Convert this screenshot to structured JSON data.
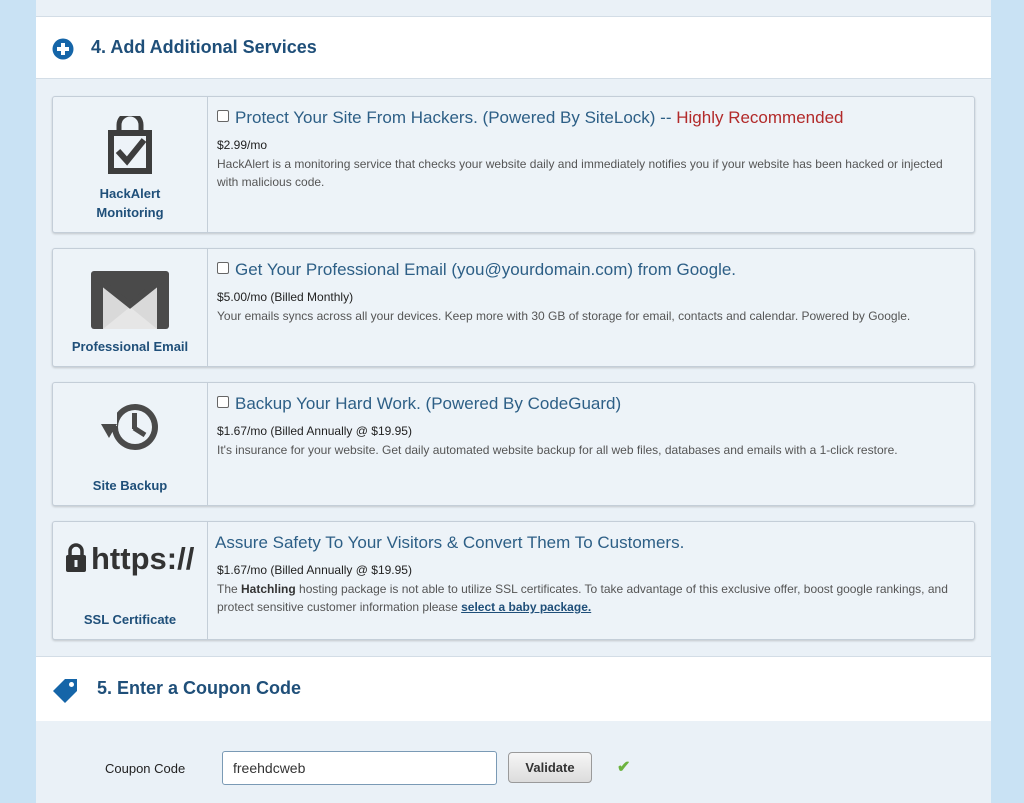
{
  "colors": {
    "accent": "#1f4f79",
    "offer_text": "#2d5f86",
    "highlight": "#b22a2a",
    "success": "#6cb33f",
    "outer_bg": "#c9e2f4"
  },
  "section4": {
    "title": "4. Add Additional Services",
    "icon": "plus-circle-icon"
  },
  "services": [
    {
      "label_line1": "HackAlert",
      "label_line2": "Monitoring",
      "icon": "shield-check-icon",
      "offer": "Protect Your Site From Hackers. (Powered By SiteLock) --",
      "offer_highlight": "Highly Recommended",
      "price": "$2.99/mo",
      "description": "HackAlert is a monitoring service that checks your website daily and immediately notifies you if your website has been hacked or injected with malicious code.",
      "checked": false
    },
    {
      "label_line1": "Professional Email",
      "icon": "gmail-envelope-icon",
      "offer": "Get Your Professional Email (you@yourdomain.com) from Google.",
      "price": "$5.00/mo (Billed Monthly)",
      "description": "Your emails syncs across all your devices. Keep more with 30 GB of storage for email, contacts and calendar. Powered by Google.",
      "checked": false
    },
    {
      "label_line1": "Site Backup",
      "icon": "history-clock-icon",
      "offer": "Backup Your Hard Work. (Powered By CodeGuard)",
      "price": "$1.67/mo (Billed Annually @ $19.95)",
      "description": "It's insurance for your website. Get daily automated website backup for all web files, databases and emails with a 1-click restore.",
      "checked": false
    },
    {
      "label_line1": "SSL Certificate",
      "icon": "lock-icon",
      "art_text": "https://",
      "offer": "Assure Safety To Your Visitors & Convert Them To Customers.",
      "price": "$1.67/mo (Billed Annually @ $19.95)",
      "desc_part1": "The ",
      "desc_bold": "Hatchling",
      "desc_part2": " hosting package is not able to utilize SSL certificates. To take advantage of this exclusive offer, boost google rankings, and protect sensitive customer information please ",
      "desc_link": "select a baby package."
    }
  ],
  "section5": {
    "title": "5. Enter a Coupon Code",
    "icon": "tag-icon"
  },
  "coupon": {
    "label": "Coupon Code",
    "value": "freehdcweb",
    "button": "Validate",
    "status_icon": "checkmark-icon",
    "status_glyph": "✔"
  }
}
